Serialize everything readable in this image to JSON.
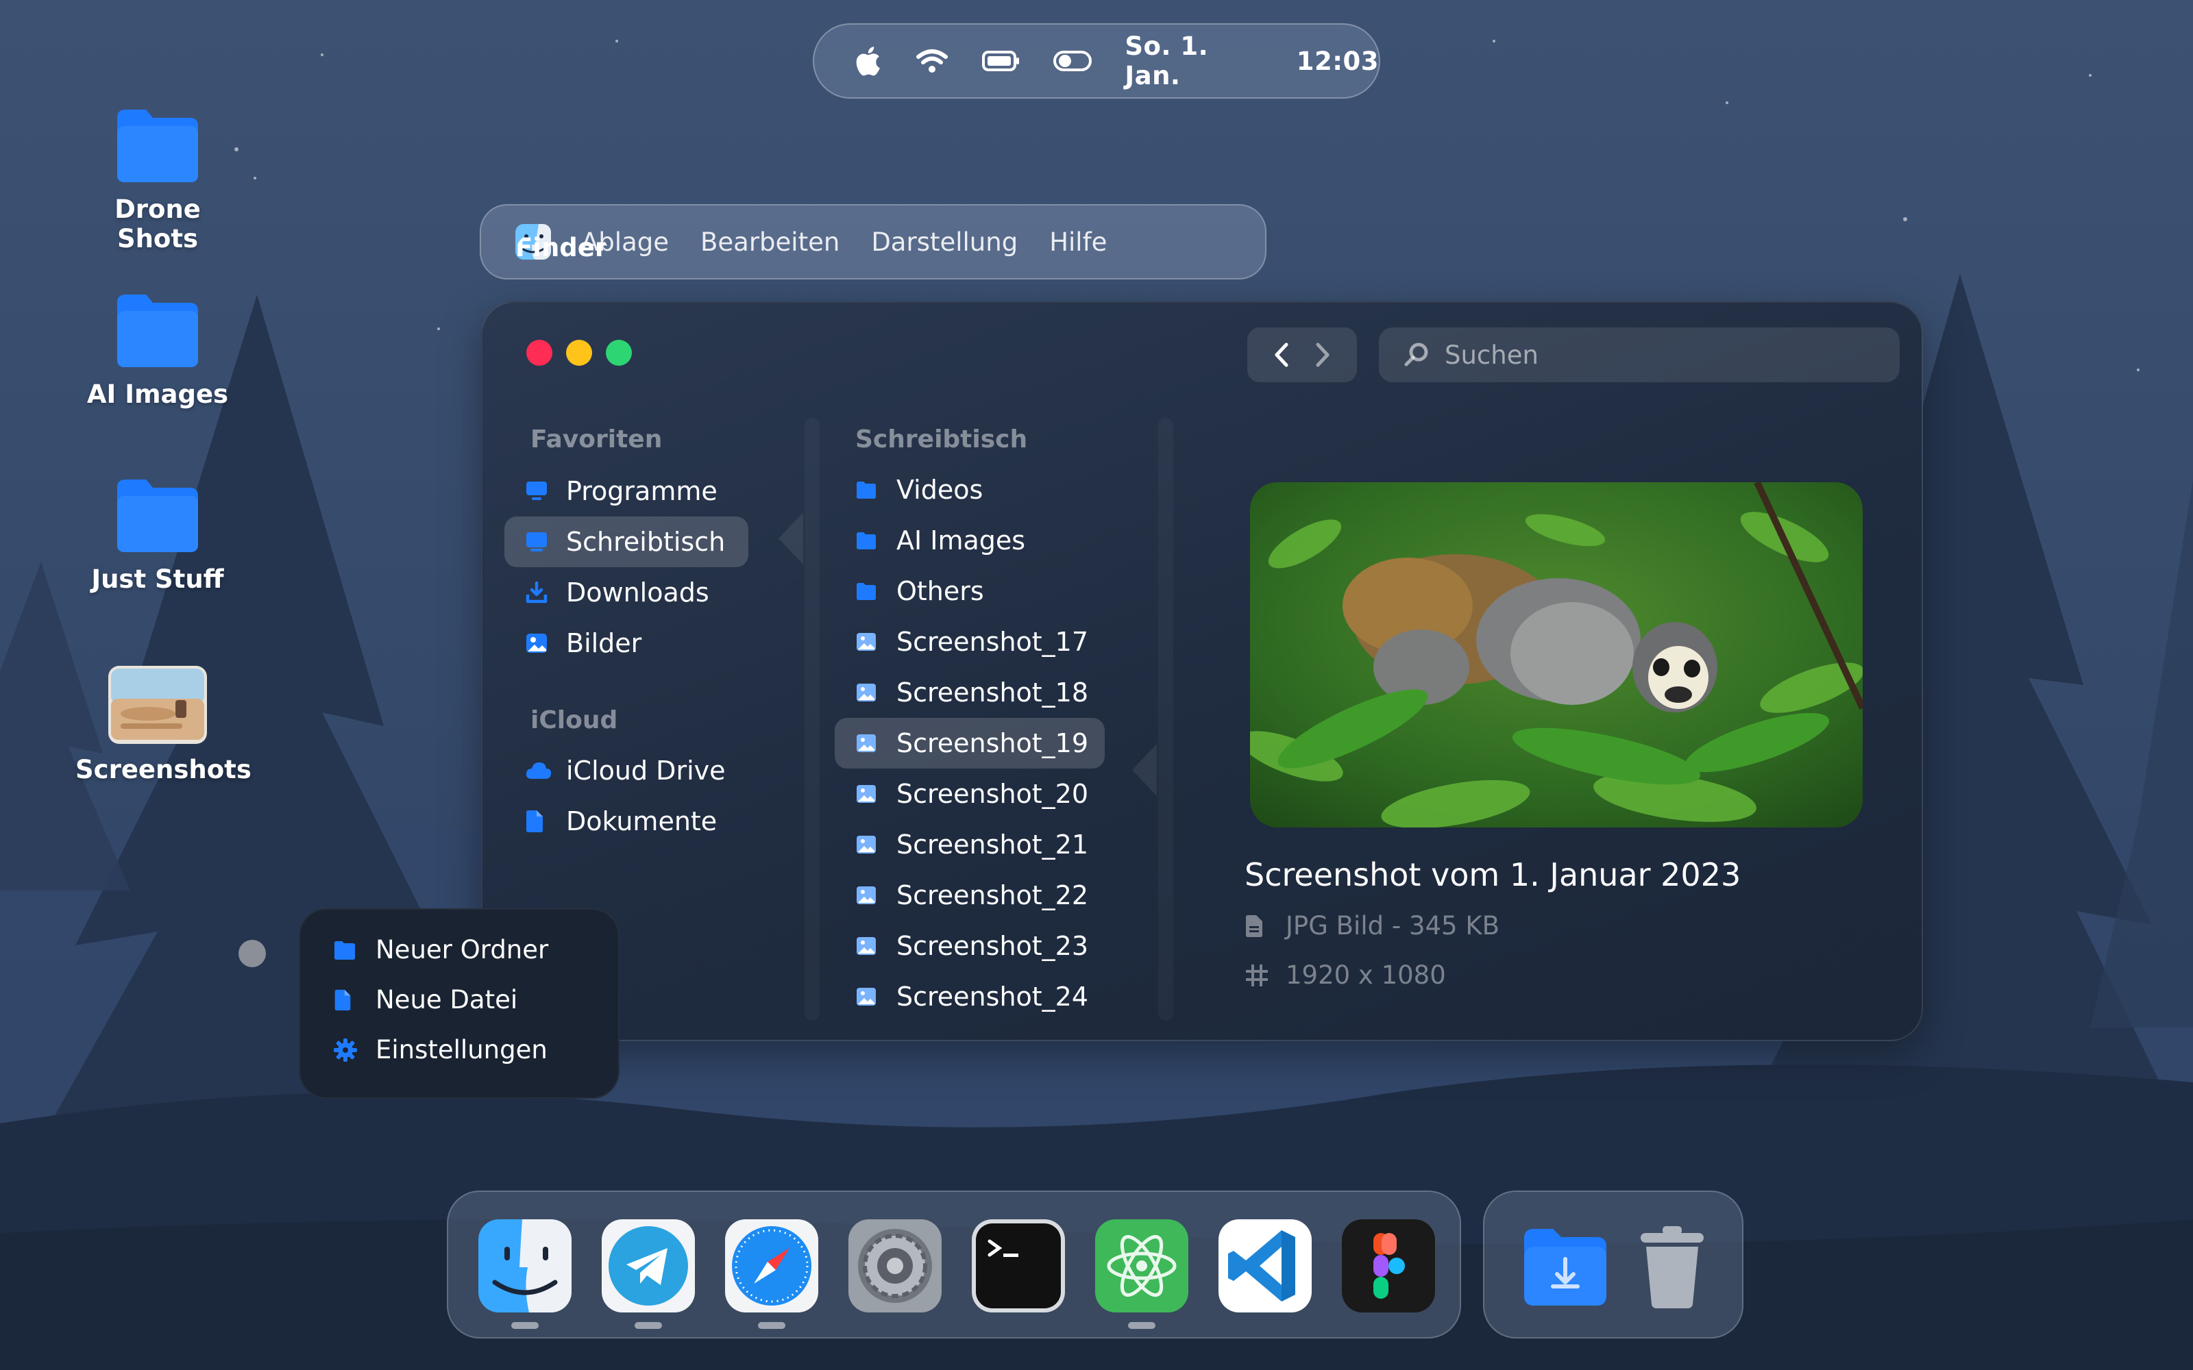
{
  "status_bar": {
    "date": "So. 1. Jan.",
    "time": "12:03"
  },
  "desktop": {
    "items": [
      {
        "label": "Drone Shots",
        "icon": "folder-icon"
      },
      {
        "label": "AI Images",
        "icon": "folder-icon"
      },
      {
        "label": "Just Stuff",
        "icon": "folder-icon"
      },
      {
        "label": "Screenshots",
        "icon": "image-thumbnail"
      }
    ]
  },
  "menubar": {
    "app_name": "Finder",
    "items": [
      "Ablage",
      "Bearbeiten",
      "Darstellung",
      "Hilfe"
    ]
  },
  "finder": {
    "search_placeholder": "Suchen",
    "sidebar": {
      "favorites_title": "Favoriten",
      "favorites": [
        {
          "label": "Programme",
          "icon": "monitor-icon"
        },
        {
          "label": "Schreibtisch",
          "icon": "desktop-icon",
          "selected": true
        },
        {
          "label": "Downloads",
          "icon": "download-icon"
        },
        {
          "label": "Bilder",
          "icon": "image-icon"
        }
      ],
      "icloud_title": "iCloud",
      "icloud": [
        {
          "label": "iCloud Drive",
          "icon": "cloud-icon"
        },
        {
          "label": "Dokumente",
          "icon": "document-icon"
        }
      ]
    },
    "column": {
      "title": "Schreibtisch",
      "items": [
        {
          "label": "Videos",
          "icon": "folder-icon"
        },
        {
          "label": "AI Images",
          "icon": "folder-icon"
        },
        {
          "label": "Others",
          "icon": "folder-icon"
        },
        {
          "label": "Screenshot_17",
          "icon": "image-file-icon"
        },
        {
          "label": "Screenshot_18",
          "icon": "image-file-icon"
        },
        {
          "label": "Screenshot_19",
          "icon": "image-file-icon",
          "selected": true
        },
        {
          "label": "Screenshot_20",
          "icon": "image-file-icon"
        },
        {
          "label": "Screenshot_21",
          "icon": "image-file-icon"
        },
        {
          "label": "Screenshot_22",
          "icon": "image-file-icon"
        },
        {
          "label": "Screenshot_23",
          "icon": "image-file-icon"
        },
        {
          "label": "Screenshot_24",
          "icon": "image-file-icon"
        }
      ]
    },
    "preview": {
      "title": "Screenshot vom 1. Januar 2023",
      "type_size": "JPG Bild - 345 KB",
      "dimensions": "1920 x 1080"
    }
  },
  "context_menu": {
    "items": [
      {
        "label": "Neuer Ordner",
        "icon": "folder-icon"
      },
      {
        "label": "Neue Datei",
        "icon": "document-icon"
      },
      {
        "label": "Einstellungen",
        "icon": "gear-icon"
      }
    ]
  },
  "dock": {
    "apps": [
      "finder-icon",
      "telegram-icon",
      "safari-icon",
      "settings-icon",
      "terminal-icon",
      "atom-icon",
      "vscode-icon",
      "figma-icon"
    ],
    "extras": [
      "downloads-folder-icon",
      "trash-icon"
    ]
  },
  "colors": {
    "accent": "#1E7BFF",
    "traffic_red": "#FF2D55",
    "traffic_yellow": "#FFC31A",
    "traffic_green": "#2ED573"
  }
}
